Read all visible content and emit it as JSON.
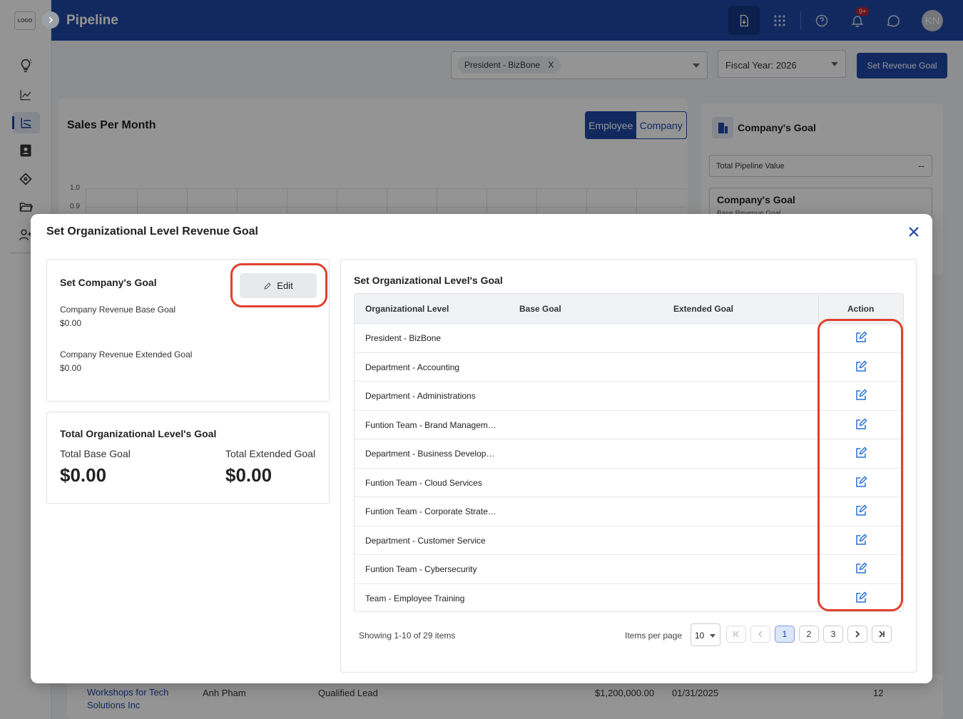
{
  "app": {
    "logo_text": "LOGO",
    "title": "Pipeline",
    "notification_count": "9+",
    "avatar_initials": "KN",
    "expand_icon": "chevron-right-icon"
  },
  "sidebar": {
    "items": [
      {
        "name": "lightbulb-icon"
      },
      {
        "name": "trend-chart-icon"
      },
      {
        "name": "pipeline-chart-icon",
        "active": true
      },
      {
        "name": "contacts-icon"
      },
      {
        "name": "tag-icon"
      },
      {
        "name": "folder-icon"
      },
      {
        "name": "add-user-icon"
      }
    ]
  },
  "filters": {
    "org_chip": "President - BizBone",
    "org_chip_remove": "X",
    "fiscal_year": "Fiscal Year: 2026",
    "set_revenue_goal": "Set Revenue Goal"
  },
  "background": {
    "chart_title": "Sales Per Month",
    "toggle_employee": "Employee",
    "toggle_company": "Company",
    "y_ticks": [
      "1.0",
      "0.9"
    ],
    "company_goal_title": "Company's Goal",
    "total_pipeline_label": "Total Pipeline Value",
    "total_pipeline_value": "--",
    "company_goal_box_title": "Company's Goal",
    "company_goal_box_sub": "Base Revenue Goal",
    "row": {
      "link_line1": "Workshops for Tech",
      "link_line2": "Solutions Inc",
      "owner": "Anh Pham",
      "stage": "Qualified Lead",
      "amount": "$1,200,000.00",
      "date": "01/31/2025",
      "count": "12"
    }
  },
  "modal": {
    "title": "Set Organizational Level Revenue Goal",
    "company_goal": {
      "title": "Set Company's Goal",
      "edit_label": "Edit",
      "base_label": "Company Revenue Base Goal",
      "base_value": "$0.00",
      "extended_label": "Company Revenue Extended Goal",
      "extended_value": "$0.00"
    },
    "totals": {
      "title": "Total Organizational Level's Goal",
      "base_label": "Total Base Goal",
      "base_value": "$0.00",
      "extended_label": "Total Extended Goal",
      "extended_value": "$0.00"
    },
    "org_table": {
      "title": "Set Organizational Level's Goal",
      "headers": {
        "level": "Organizational Level",
        "base": "Base Goal",
        "extended": "Extended Goal",
        "action": "Action"
      },
      "rows": [
        {
          "level": "President - BizBone"
        },
        {
          "level": "Department - Accounting"
        },
        {
          "level": "Department - Administrations"
        },
        {
          "level": "Funtion Team - Brand Managem…"
        },
        {
          "level": "Department - Business Develop…"
        },
        {
          "level": "Funtion Team - Cloud Services"
        },
        {
          "level": "Funtion Team - Corporate Strate…"
        },
        {
          "level": "Department - Customer Service"
        },
        {
          "level": "Funtion Team - Cybersecurity"
        },
        {
          "level": "Team - Employee Training"
        }
      ]
    },
    "pagination": {
      "showing": "Showing 1-10 of 29 items",
      "items_per_page_label": "Items per page",
      "items_per_page": "10",
      "pages": [
        "1",
        "2",
        "3"
      ],
      "current_page": "1"
    }
  },
  "colors": {
    "brand": "#1f47a5",
    "highlight": "#e0412f",
    "edit_icon": "#2a6fd6"
  }
}
